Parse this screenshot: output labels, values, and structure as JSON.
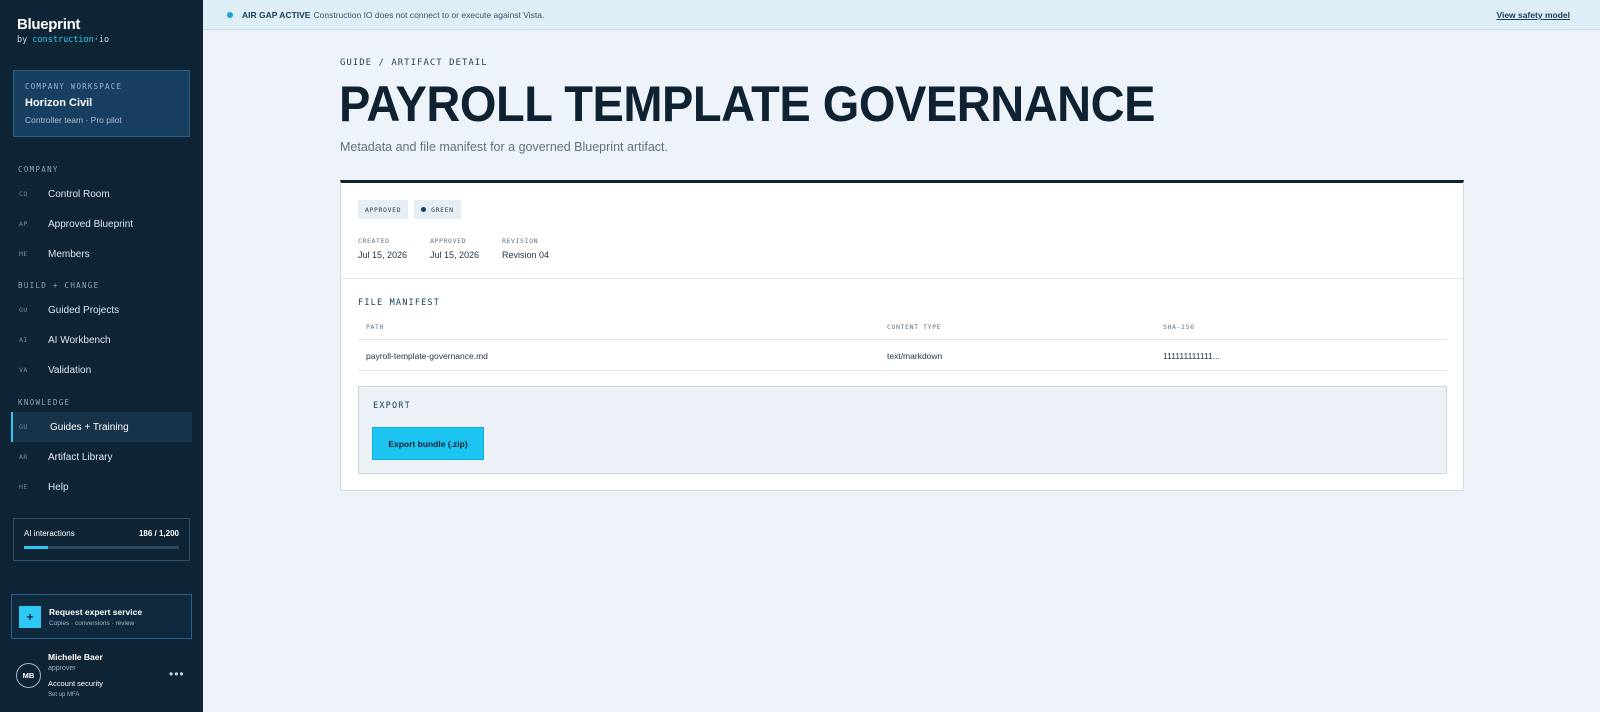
{
  "brand": {
    "name": "Blueprint",
    "by_prefix": "by ",
    "by_accent": "construction",
    "by_suffix": "·io"
  },
  "workspace": {
    "label": "COMPANY WORKSPACE",
    "name": "Horizon Civil",
    "sub": "Controller team · Pro pilot"
  },
  "sidebar": {
    "sections": [
      {
        "label": "COMPANY",
        "items": [
          {
            "code": "CO",
            "label": "Control Room",
            "icon": "control-room-icon"
          },
          {
            "code": "AP",
            "label": "Approved Blueprint",
            "icon": "approved-blueprint-icon"
          },
          {
            "code": "ME",
            "label": "Members",
            "icon": "members-icon"
          }
        ]
      },
      {
        "label": "BUILD + CHANGE",
        "items": [
          {
            "code": "GU",
            "label": "Guided Projects",
            "icon": "guided-projects-icon"
          },
          {
            "code": "AI",
            "label": "AI Workbench",
            "icon": "ai-workbench-icon"
          },
          {
            "code": "VA",
            "label": "Validation",
            "icon": "validation-icon"
          }
        ]
      },
      {
        "label": "KNOWLEDGE",
        "items": [
          {
            "code": "GU",
            "label": "Guides + Training",
            "icon": "guides-training-icon",
            "active": true
          },
          {
            "code": "AR",
            "label": "Artifact Library",
            "icon": "artifact-library-icon"
          },
          {
            "code": "HE",
            "label": "Help",
            "icon": "help-icon"
          }
        ]
      }
    ]
  },
  "usage": {
    "label": "AI interactions",
    "count": "186 / 1,200",
    "fraction": 0.155
  },
  "request": {
    "icon": "+",
    "title": "Request expert service",
    "sub": "Copies · conversions · review"
  },
  "user": {
    "initials": "MB",
    "name": "Michelle Baer",
    "role": "approver",
    "security": "Account security",
    "mfa": "Set up MFA",
    "more": "•••"
  },
  "banner": {
    "strong": "AIR GAP ACTIVE",
    "text": "Construction IO does not connect to or execute against Vista.",
    "link": "View safety model"
  },
  "page": {
    "breadcrumb": "GUIDE / ARTIFACT DETAIL",
    "title": "PAYROLL TEMPLATE GOVERNANCE",
    "subtitle": "Metadata and file manifest for a governed Blueprint artifact."
  },
  "artifact": {
    "badges": {
      "status": "APPROVED",
      "health": "GREEN"
    },
    "meta": [
      {
        "label": "CREATED",
        "value": "Jul 15, 2026"
      },
      {
        "label": "APPROVED",
        "value": "Jul 15, 2026"
      },
      {
        "label": "REVISION",
        "value": "Revision 04"
      }
    ]
  },
  "manifest": {
    "title": "FILE MANIFEST",
    "columns": [
      "PATH",
      "CONTENT TYPE",
      "SHA-256"
    ],
    "rows": [
      [
        "payroll-template-governance.md",
        "text/markdown",
        "111111111111..."
      ]
    ]
  },
  "export": {
    "title": "EXPORT",
    "button": "Export bundle (.zip)"
  },
  "colors": {
    "accent": "#2ec8f4",
    "sidebar": "#0f2434",
    "page_bg": "#eef3fa",
    "button": "#1cc4f2"
  }
}
